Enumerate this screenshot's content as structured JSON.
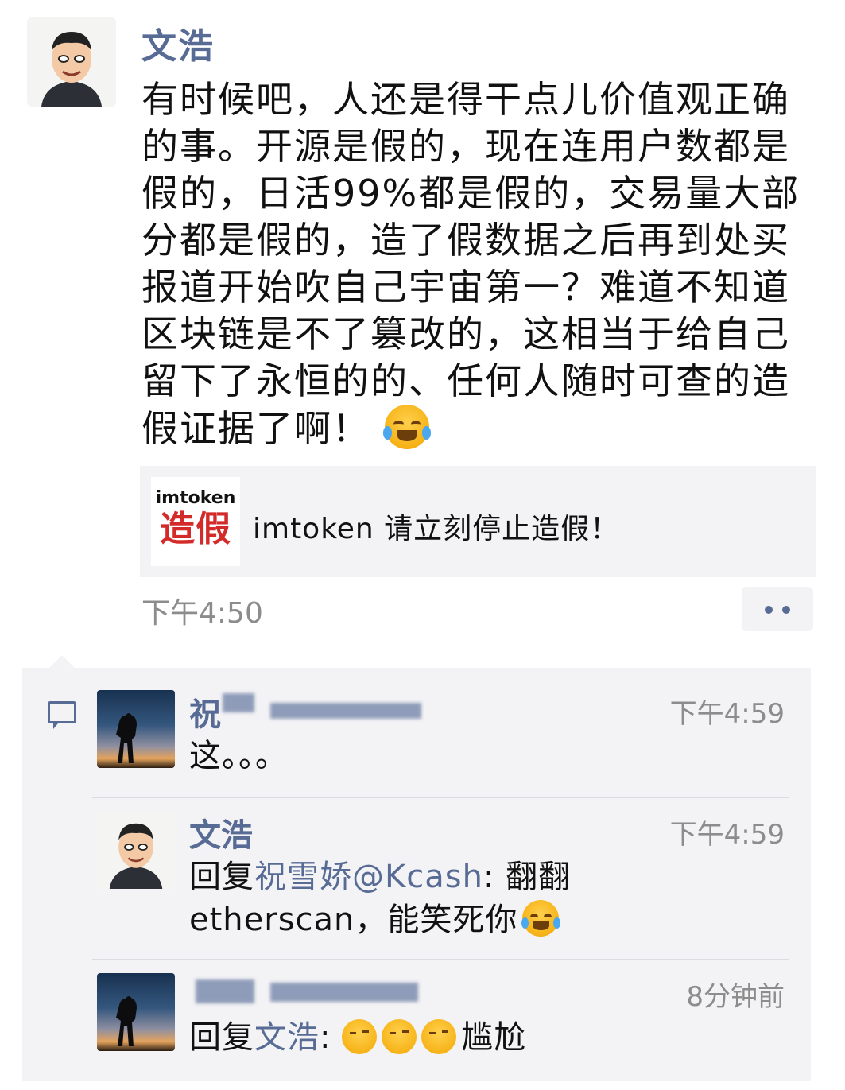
{
  "post": {
    "author": "文浩",
    "text": "有时候吧，人还是得干点儿价值观正确的事。开源是假的，现在连用户数都是假的，日活99%都是假的，交易量大部分都是假的，造了假数据之后再到处买报道开始吹自己宇宙第一？难道不知道区块链是不了篡改的，这相当于给自己留下了永恒的的、任何人随时可查的造假证据了啊！",
    "emoji": "loudly-crying-face",
    "share": {
      "thumb_top": "imtoken",
      "thumb_big": "造假",
      "title": "imtoken 请立刻停止造假！"
    },
    "time": "下午4:50",
    "more_icon": "more-dots-icon"
  },
  "comments": [
    {
      "name_visible": "祝",
      "time": "下午4:59",
      "text": "这。。。"
    },
    {
      "name": "文浩",
      "time": "下午4:59",
      "reply_prefix": "回复",
      "reply_to": "祝雪娇@Kcash",
      "text": ": 翻翻 etherscan，能笑死你"
    },
    {
      "time": "8分钟前",
      "reply_prefix": "回复",
      "reply_to": "文浩",
      "text_suffix": "尴尬"
    }
  ],
  "colors": {
    "link": "#576b95",
    "bg_comments": "#f3f3f5"
  }
}
